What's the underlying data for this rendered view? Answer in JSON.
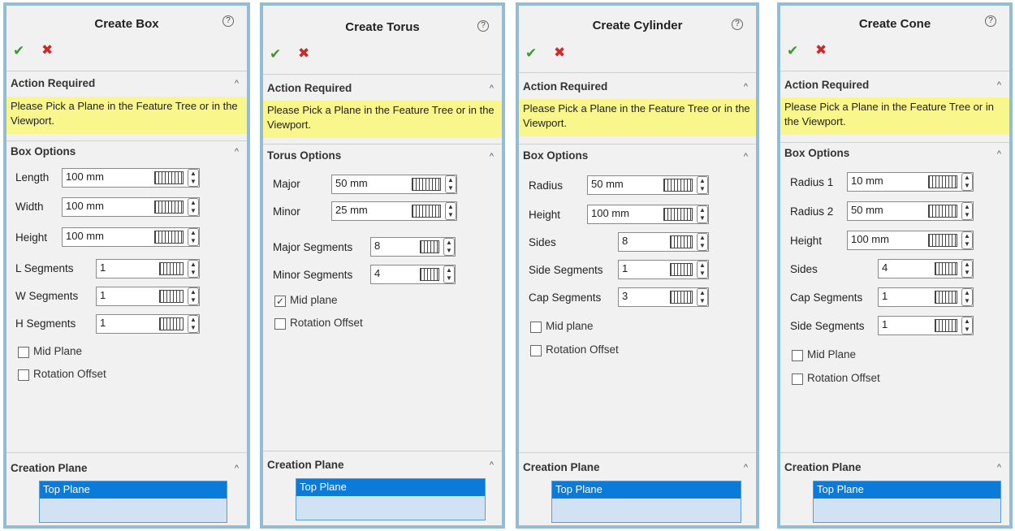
{
  "labels": {
    "help": "?",
    "ok": "✔",
    "cancel": "✖",
    "action_required": "Action Required",
    "action_note": "Please Pick a Plane in the Feature Tree or in the Viewport.",
    "creation_plane": "Creation Plane",
    "top_plane": "Top Plane",
    "chevron": "^",
    "check": "✓"
  },
  "box": {
    "title": "Create Box",
    "options_title": "Box Options",
    "rows": [
      {
        "label": "Length",
        "value": "100 mm"
      },
      {
        "label": "Width",
        "value": "100 mm"
      },
      {
        "label": "Height",
        "value": "100 mm"
      },
      {
        "label": "L Segments",
        "value": "1"
      },
      {
        "label": "W Segments",
        "value": "1"
      },
      {
        "label": "H Segments",
        "value": "1"
      }
    ],
    "checks": [
      {
        "label": "Mid Plane",
        "checked": false
      },
      {
        "label": "Rotation Offset",
        "checked": false
      }
    ]
  },
  "torus": {
    "title": "Create Torus",
    "options_title": "Torus Options",
    "rows": [
      {
        "label": "Major",
        "value": "50 mm"
      },
      {
        "label": "Minor",
        "value": "25 mm"
      },
      {
        "label": "Major Segments",
        "value": "8"
      },
      {
        "label": "Minor Segments",
        "value": "4"
      }
    ],
    "checks": [
      {
        "label": "Mid plane",
        "checked": true
      },
      {
        "label": "Rotation Offset",
        "checked": false
      }
    ]
  },
  "cylinder": {
    "title": "Create Cylinder",
    "options_title": "Box Options",
    "rows": [
      {
        "label": "Radius",
        "value": "50 mm"
      },
      {
        "label": "Height",
        "value": "100 mm"
      },
      {
        "label": "Sides",
        "value": "8"
      },
      {
        "label": "Side Segments",
        "value": "1"
      },
      {
        "label": "Cap Segments",
        "value": "3"
      }
    ],
    "checks": [
      {
        "label": "Mid plane",
        "checked": false
      },
      {
        "label": "Rotation Offset",
        "checked": false
      }
    ]
  },
  "cone": {
    "title": "Create Cone",
    "options_title": "Box Options",
    "rows": [
      {
        "label": "Radius 1",
        "value": "10 mm"
      },
      {
        "label": "Radius 2",
        "value": "50 mm"
      },
      {
        "label": "Height",
        "value": "100 mm"
      },
      {
        "label": "Sides",
        "value": "4"
      },
      {
        "label": "Cap Segments",
        "value": "1"
      },
      {
        "label": "Side Segments",
        "value": "1"
      }
    ],
    "checks": [
      {
        "label": "Mid Plane",
        "checked": false
      },
      {
        "label": "Rotation Offset",
        "checked": false
      }
    ]
  }
}
